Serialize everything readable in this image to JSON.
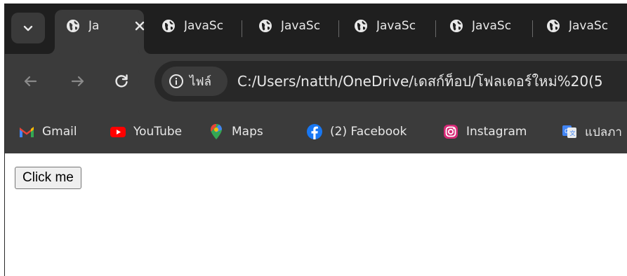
{
  "tabs": [
    {
      "title": "Ja",
      "active": true
    },
    {
      "title": "JavaSc",
      "active": false
    },
    {
      "title": "JavaSc",
      "active": false
    },
    {
      "title": "JavaSc",
      "active": false
    },
    {
      "title": "JavaSc",
      "active": false
    },
    {
      "title": "JavaSc",
      "active": false
    }
  ],
  "toolbar": {
    "site_info_label": "ไฟล์",
    "url": "C:/Users/natth/OneDrive/เดสก์ท็อป/โฟลเดอร์ใหม่%20(5"
  },
  "bookmarks": [
    {
      "label": "Gmail",
      "icon": "gmail-icon"
    },
    {
      "label": "YouTube",
      "icon": "youtube-icon"
    },
    {
      "label": "Maps",
      "icon": "maps-icon"
    },
    {
      "label": "(2) Facebook",
      "icon": "facebook-icon"
    },
    {
      "label": "Instagram",
      "icon": "instagram-icon"
    },
    {
      "label": "แปลภา",
      "icon": "translate-icon"
    }
  ],
  "page": {
    "button_label": "Click me"
  },
  "colors": {
    "tabstrip_bg": "#1f1f1f",
    "toolbar_bg": "#3b3b3b",
    "omnibox_bg": "#282828",
    "text": "#e8e8e8"
  }
}
